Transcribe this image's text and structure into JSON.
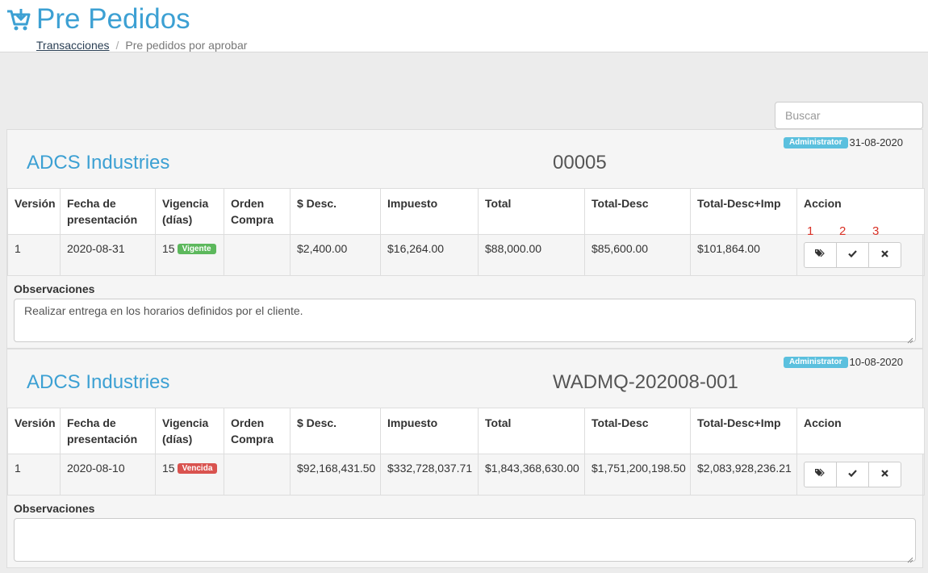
{
  "header": {
    "title": "Pre Pedidos",
    "breadcrumb": {
      "link": "Transacciones",
      "separator": "/",
      "current": "Pre pedidos por aprobar"
    }
  },
  "search": {
    "placeholder": "Buscar"
  },
  "table_headers": [
    "Versión",
    "Fecha de presentación",
    "Vigencia (días)",
    "Orden Compra",
    "$ Desc.",
    "Impuesto",
    "Total",
    "Total-Desc",
    "Total-Desc+Imp",
    "Accion"
  ],
  "observations_label": "Observaciones",
  "action_markers": [
    "1",
    "2",
    "3"
  ],
  "orders": [
    {
      "company": "ADCS Industries",
      "code": "00005",
      "role_badge": "Administrator",
      "date": "31-08-2020",
      "row": {
        "version": "1",
        "fecha": "2020-08-31",
        "vigencia": "15",
        "status": "Vigente",
        "orden_compra": "",
        "desc": "$2,400.00",
        "impuesto": "$16,264.00",
        "total": "$88,000.00",
        "total_desc": "$85,600.00",
        "total_desc_imp": "$101,864.00"
      },
      "observaciones": "Realizar entrega en los horarios definidos por el cliente."
    },
    {
      "company": "ADCS Industries",
      "code": "WADMQ-202008-001",
      "role_badge": "Administrator",
      "date": "10-08-2020",
      "row": {
        "version": "1",
        "fecha": "2020-08-10",
        "vigencia": "15",
        "status": "Vencida",
        "orden_compra": "",
        "desc": "$92,168,431.50",
        "impuesto": "$332,728,037.71",
        "total": "$1,843,368,630.00",
        "total_desc": "$1,751,200,198.50",
        "total_desc_imp": "$2,083,928,236.21"
      },
      "observaciones": ""
    }
  ],
  "colors": {
    "accent": "#3ca0d3",
    "vigente": "#5cb85c",
    "vencida": "#d9534f",
    "admin_badge": "#5bc0de"
  },
  "icons": {
    "cart": "cart-download-icon",
    "tag": "tags-icon",
    "approve": "check-icon",
    "reject": "close-icon"
  }
}
